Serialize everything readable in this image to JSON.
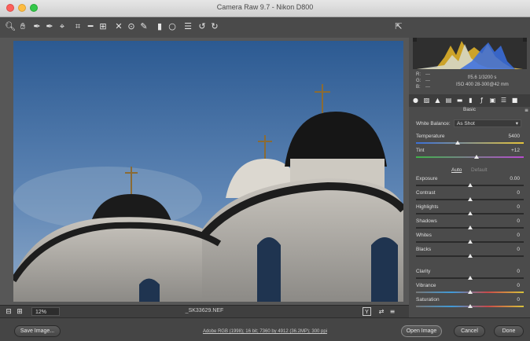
{
  "window": {
    "title": "Camera Raw 9.7  -  Nikon D800"
  },
  "toolbar": {
    "tools": [
      "zoom-icon",
      "hand-icon",
      "white-balance-icon",
      "color-sampler-icon",
      "target-adjust-icon",
      "crop-icon",
      "straighten-icon",
      "transform-icon",
      "spot-removal-icon",
      "redeye-icon",
      "brush-icon",
      "graduated-filter-icon",
      "radial-filter-icon",
      "preferences-icon",
      "rotate-ccw-icon",
      "rotate-cw-icon"
    ],
    "fullscreen_icon": "fullscreen-icon"
  },
  "histogram": {
    "rgb": {
      "r_label": "R:",
      "g_label": "G:",
      "b_label": "B:",
      "r": "---",
      "g": "---",
      "b": "---"
    },
    "exposure_info": "f/5.6   1/3200 s",
    "lens_info": "ISO 400   28-300@42 mm"
  },
  "panel_tabs": [
    "basic-tab-icon",
    "tone-curve-tab-icon",
    "detail-tab-icon",
    "hsl-tab-icon",
    "split-tone-tab-icon",
    "lens-tab-icon",
    "fx-tab-icon",
    "camera-cal-tab-icon",
    "presets-tab-icon",
    "snapshots-tab-icon"
  ],
  "basic": {
    "title": "Basic",
    "white_balance_label": "White Balance:",
    "white_balance_value": "As Shot",
    "temperature": {
      "label": "Temperature",
      "value": "5400",
      "position": 0.39
    },
    "tint": {
      "label": "Tint",
      "value": "+12",
      "position": 0.56
    },
    "auto_label": "Auto",
    "default_label": "Default",
    "sliders": [
      {
        "label": "Exposure",
        "value": "0.00",
        "position": 0.5
      },
      {
        "label": "Contrast",
        "value": "0",
        "position": 0.5
      },
      {
        "label": "Highlights",
        "value": "0",
        "position": 0.5
      },
      {
        "label": "Shadows",
        "value": "0",
        "position": 0.5
      },
      {
        "label": "Whites",
        "value": "0",
        "position": 0.5
      },
      {
        "label": "Blacks",
        "value": "0",
        "position": 0.5
      },
      {
        "label": "Clarity",
        "value": "0",
        "position": 0.5
      },
      {
        "label": "Vibrance",
        "value": "0",
        "position": 0.5
      },
      {
        "label": "Saturation",
        "value": "0",
        "position": 0.5
      }
    ]
  },
  "status": {
    "zoom": "12%",
    "filename": "_SK33629.NEF",
    "compare_label": "Y"
  },
  "footer": {
    "save_label": "Save Image...",
    "workflow": "Adobe RGB (1998); 16 bit; 7360 by 4912 (36.2MP); 300 ppi",
    "open_label": "Open Image",
    "cancel_label": "Cancel",
    "done_label": "Done"
  },
  "colors": {
    "accent": "#3b8bd6",
    "panel": "#4b4b4b"
  }
}
